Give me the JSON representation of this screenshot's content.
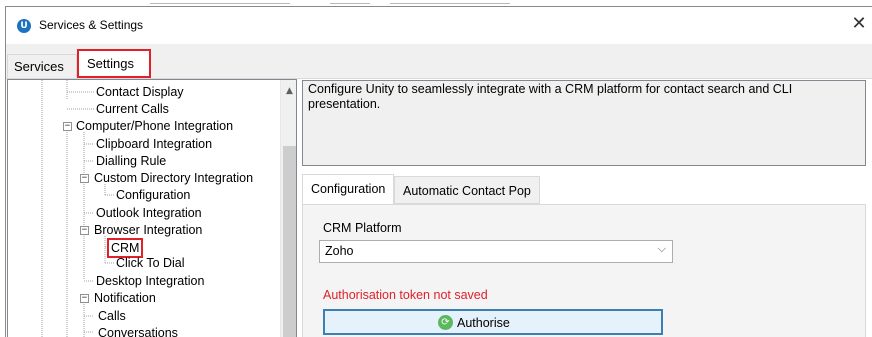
{
  "window": {
    "title": "Services & Settings",
    "app_icon_letter": "U",
    "close_glyph": "✕"
  },
  "tabs": {
    "services": "Services",
    "settings": "Settings"
  },
  "tree": {
    "items": [
      "Contact Display",
      "Current Calls",
      "Computer/Phone Integration",
      "Clipboard Integration",
      "Dialling Rule",
      "Custom Directory Integration",
      "Configuration",
      "Outlook Integration",
      "Browser Integration",
      "CRM",
      "Click To Dial",
      "Desktop Integration",
      "Notification",
      "Calls",
      "Conversations"
    ],
    "expander_glyph": "−"
  },
  "description": "Configure Unity to seamlessly integrate with a CRM platform for contact search and CLI presentation.",
  "inner_tabs": {
    "configuration": "Configuration",
    "auto_contact_pop": "Automatic Contact Pop"
  },
  "config": {
    "crm_platform_label": "CRM Platform",
    "crm_platform_value": "Zoho",
    "auth_warning": "Authorisation token not saved",
    "authorise_label": "Authorise"
  },
  "colors": {
    "highlight_red": "#e0202a",
    "button_border": "#3c7fb1",
    "app_blue": "#1e73be"
  }
}
